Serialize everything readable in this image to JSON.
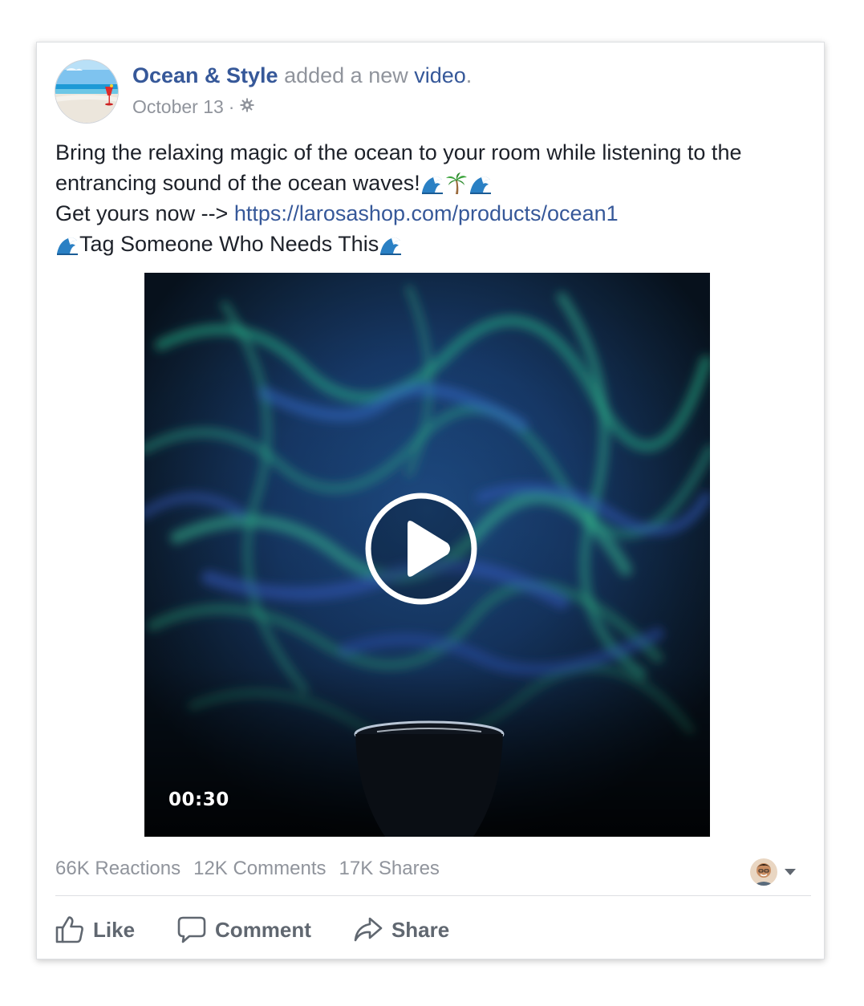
{
  "post": {
    "page_name": "Ocean & Style",
    "action_text": "added a new",
    "object_link": "video",
    "period": ".",
    "date": "October 13",
    "separator": "·",
    "privacy_icon": "globe-gear-icon"
  },
  "body": {
    "line1": "Bring the relaxing magic of the ocean to your room while listening to the",
    "line2": "entrancing sound of the ocean waves!",
    "line3_prefix": "Get yours now -->",
    "link": "https://larosashop.com/products/ocean1",
    "line4": "Tag Someone Who Needs This",
    "emojis": [
      "wave-emoji",
      "palm-tree-emoji"
    ]
  },
  "video": {
    "duration": "00:30",
    "play_icon": "play-icon"
  },
  "stats": {
    "reactions": "66K Reactions",
    "comments": "12K Comments",
    "shares": "17K Shares"
  },
  "actions": {
    "like": "Like",
    "comment": "Comment",
    "share": "Share"
  },
  "colors": {
    "link": "#365899",
    "secondary_text": "#90949c",
    "body_text": "#1d2129",
    "action_text": "#606770"
  }
}
